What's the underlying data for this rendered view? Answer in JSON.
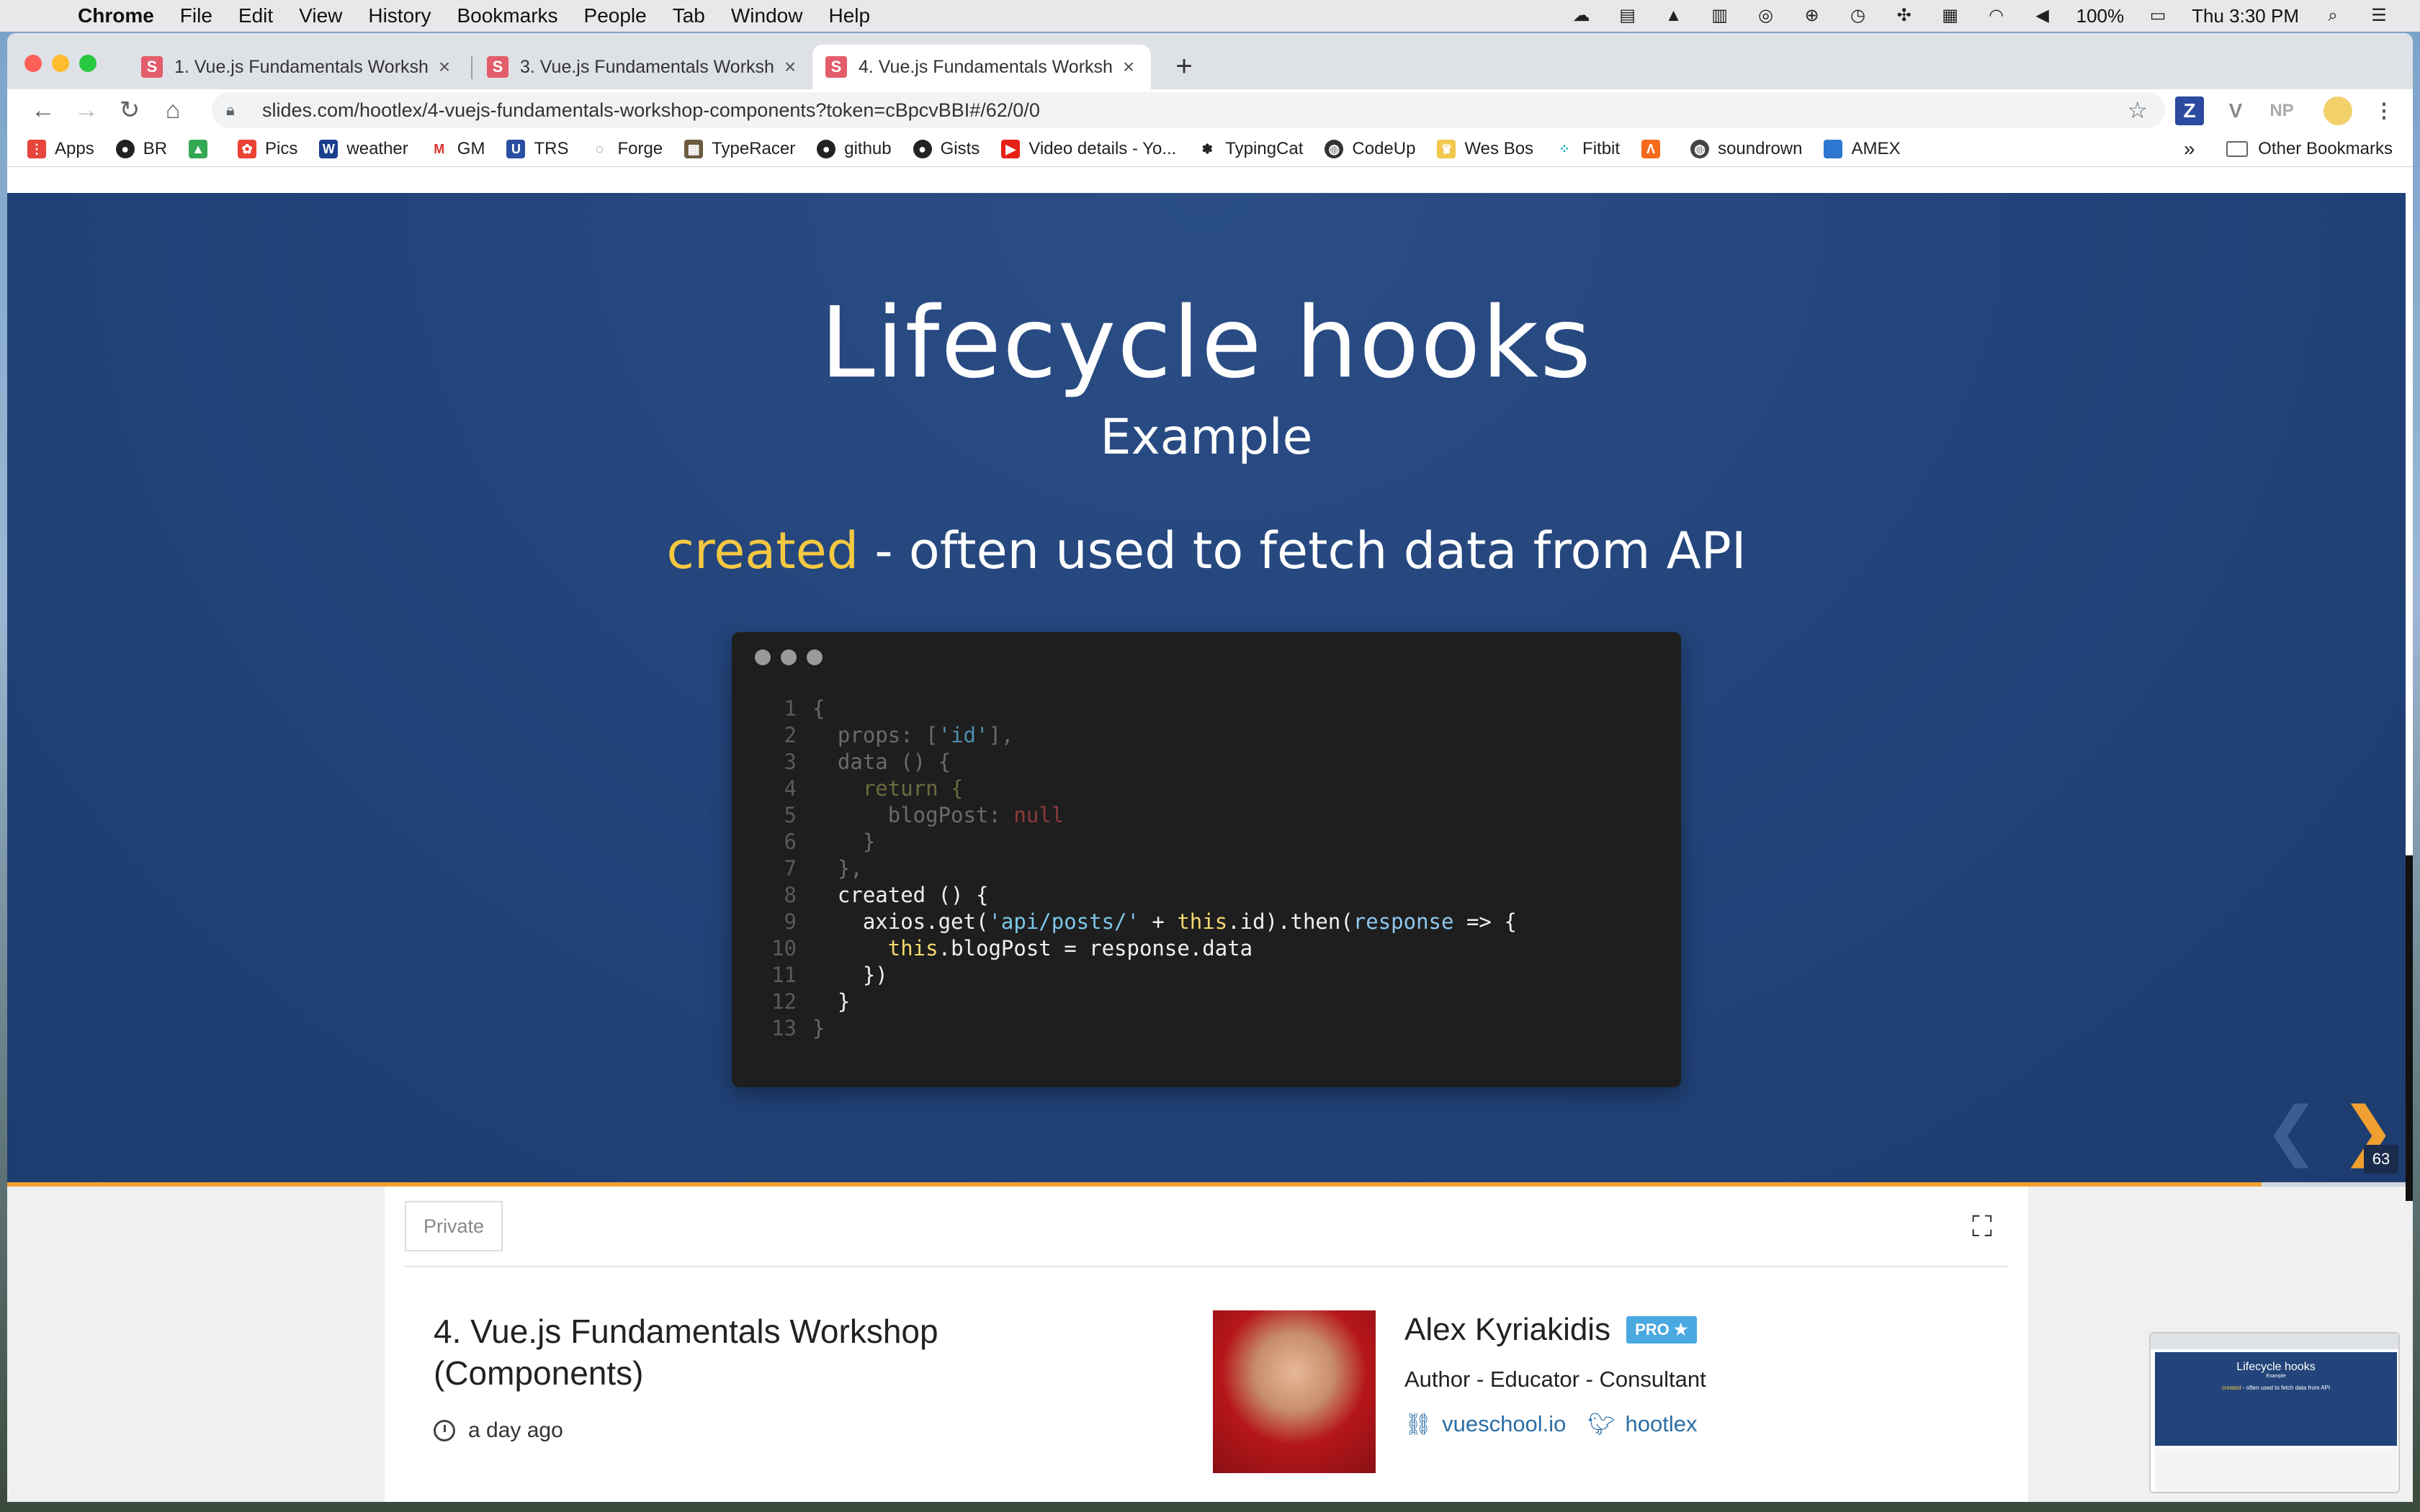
{
  "menubar": {
    "app": "Chrome",
    "items": [
      "File",
      "Edit",
      "View",
      "History",
      "Bookmarks",
      "People",
      "Tab",
      "Window",
      "Help"
    ],
    "battery": "100%",
    "clock": "Thu 3:30 PM"
  },
  "tabs": [
    {
      "favicon": "S",
      "title": "1. Vue.js Fundamentals Worksh"
    },
    {
      "favicon": "S",
      "title": "3. Vue.js Fundamentals Worksh"
    },
    {
      "favicon": "S",
      "title": "4. Vue.js Fundamentals Worksh"
    }
  ],
  "address": {
    "url": "slides.com/hootlex/4-vuejs-fundamentals-workshop-components?token=cBpcvBBI#/62/0/0"
  },
  "extensions": [
    "Z",
    "V",
    "NP"
  ],
  "bookmarks": [
    {
      "label": "Apps",
      "color": "#e8453c"
    },
    {
      "label": "BR",
      "color": "#222222"
    },
    {
      "label": "",
      "color": "#34a853"
    },
    {
      "label": "Pics",
      "color": "#ea4335"
    },
    {
      "label": "weather",
      "color": "#1a3f8f"
    },
    {
      "label": "GM",
      "color": "#d93025"
    },
    {
      "label": "TRS",
      "color": "#2a4fa0"
    },
    {
      "label": "Forge",
      "color": "#555555"
    },
    {
      "label": "TypeRacer",
      "color": "#6b5b3e"
    },
    {
      "label": "github",
      "color": "#222222"
    },
    {
      "label": "Gists",
      "color": "#222222"
    },
    {
      "label": "Video details - Yo...",
      "color": "#e62117"
    },
    {
      "label": "TypingCat",
      "color": "#222222"
    },
    {
      "label": "CodeUp",
      "color": "#333333"
    },
    {
      "label": "Wes Bos",
      "color": "#f2c94c"
    },
    {
      "label": "Fitbit",
      "color": "#00b0b9"
    },
    {
      "label": "",
      "color": "#f56a1b"
    },
    {
      "label": "soundrown",
      "color": "#444444"
    },
    {
      "label": "AMEX",
      "color": "#2e77d0"
    }
  ],
  "bookmarks_overflow": "»",
  "other_bookmarks": "Other Bookmarks",
  "slide": {
    "title": "Lifecycle hooks",
    "subtitle": "Example",
    "keyword": "created",
    "line_rest": " - often used to fetch data from API",
    "number": "63",
    "progress_fraction": 0.94
  },
  "code": [
    {
      "n": "1",
      "text": "{",
      "style": "dim"
    },
    {
      "n": "2",
      "text": "  props: [",
      "style": "dim",
      "str": "'id'",
      "after": "],"
    },
    {
      "n": "3",
      "text": "  data () {",
      "style": "dim"
    },
    {
      "n": "4",
      "text": "    return {",
      "style": "ret"
    },
    {
      "n": "5",
      "text": "      blogPost: ",
      "style": "dim",
      "null": "null"
    },
    {
      "n": "6",
      "text": "    }",
      "style": "dim"
    },
    {
      "n": "7",
      "text": "  },",
      "style": "dim"
    },
    {
      "n": "8",
      "text": "  created () {",
      "style": "bright"
    },
    {
      "n": "9",
      "text": "    axios.get(",
      "style": "bright",
      "bstr": "'api/posts/'",
      "mid": " + ",
      "this": "this",
      "after": ".id).then(",
      "param": "response",
      "tail": " => {"
    },
    {
      "n": "10",
      "text": "      ",
      "style": "bright",
      "this": "this",
      "after": ".blogPost = response.data"
    },
    {
      "n": "11",
      "text": "    })",
      "style": "bright"
    },
    {
      "n": "12",
      "text": "  }",
      "style": "bright"
    },
    {
      "n": "13",
      "text": "}",
      "style": "dim"
    }
  ],
  "deck": {
    "visibility": "Private",
    "title": "4. Vue.js Fundamentals Workshop (Components)",
    "time": "a day ago"
  },
  "author": {
    "name": "Alex Kyriakidis",
    "badge": "PRO ★",
    "role": "Author - Educator - Consultant",
    "website": "vueschool.io",
    "twitter": "hootlex"
  },
  "thumbnail": {
    "title": "Lifecycle hooks",
    "subtitle": "Example",
    "keyword": "created",
    "line_rest": " - often used to fetch data from API"
  }
}
